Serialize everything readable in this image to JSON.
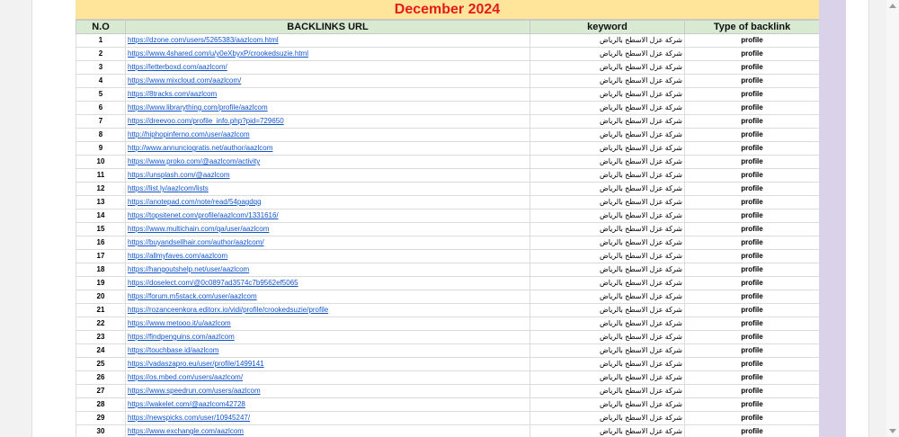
{
  "title": "December 2024",
  "headers": {
    "no": "N.O",
    "url": "BACKLINKS URL",
    "keyword": "keyword",
    "type": "Type of backlink"
  },
  "rows": [
    {
      "no": "1",
      "url": "https://dzone.com/users/5265383/aazlcom.html",
      "keyword": "شركة عزل الاسطح بالرياض",
      "type": "profile"
    },
    {
      "no": "2",
      "url": "https://www.4shared.com/u/y0eXbyxP/crookedsuzie.html",
      "keyword": "شركة عزل الاسطح بالرياض",
      "type": "profile"
    },
    {
      "no": "3",
      "url": "https://letterboxd.com/aazlcom/",
      "keyword": "شركة عزل الاسطح بالرياض",
      "type": "profile"
    },
    {
      "no": "4",
      "url": "https://www.mixcloud.com/aazlcom/",
      "keyword": "شركة عزل الاسطح بالرياض",
      "type": "profile"
    },
    {
      "no": "5",
      "url": "https://8tracks.com/aazlcom",
      "keyword": "شركة عزل الاسطح بالرياض",
      "type": "profile"
    },
    {
      "no": "6",
      "url": "https://www.librarything.com/profile/aazlcom",
      "keyword": "شركة عزل الاسطح بالرياض",
      "type": "profile"
    },
    {
      "no": "7",
      "url": "https://dreevoo.com/profile_info.php?pid=729650",
      "keyword": "شركة عزل الاسطح بالرياض",
      "type": "profile"
    },
    {
      "no": "8",
      "url": "http://hiphopinferno.com/user/aazlcom",
      "keyword": "شركة عزل الاسطح بالرياض",
      "type": "profile"
    },
    {
      "no": "9",
      "url": "http://www.annunciogratis.net/author/aazlcom",
      "keyword": "شركة عزل الاسطح بالرياض",
      "type": "profile"
    },
    {
      "no": "10",
      "url": "https://www.proko.com/@aazlcom/activity",
      "keyword": "شركة عزل الاسطح بالرياض",
      "type": "profile"
    },
    {
      "no": "11",
      "url": "https://unsplash.com/@aazlcom",
      "keyword": "شركة عزل الاسطح بالرياض",
      "type": "profile"
    },
    {
      "no": "12",
      "url": "https://list.ly/aazlcom/lists",
      "keyword": "شركة عزل الاسطح بالرياض",
      "type": "profile"
    },
    {
      "no": "13",
      "url": "https://anotepad.com/note/read/54pagdqq",
      "keyword": "شركة عزل الاسطح بالرياض",
      "type": "profile"
    },
    {
      "no": "14",
      "url": "https://topsitenet.com/profile/aazlcom/1331616/",
      "keyword": "شركة عزل الاسطح بالرياض",
      "type": "profile"
    },
    {
      "no": "15",
      "url": "https://www.multichain.com/qa/user/aazlcom",
      "keyword": "شركة عزل الاسطح بالرياض",
      "type": "profile"
    },
    {
      "no": "16",
      "url": "https://buyandsellhair.com/author/aazlcom/",
      "keyword": "شركة عزل الاسطح بالرياض",
      "type": "profile"
    },
    {
      "no": "17",
      "url": "https://allmyfaves.com/aazlcom",
      "keyword": "شركة عزل الاسطح بالرياض",
      "type": "profile"
    },
    {
      "no": "18",
      "url": "https://hangoutshelp.net/user/aazlcom",
      "keyword": "شركة عزل الاسطح بالرياض",
      "type": "profile"
    },
    {
      "no": "19",
      "url": "https://doselect.com/@0c0897ad3574c7b9562ef5065",
      "keyword": "شركة عزل الاسطح بالرياض",
      "type": "profile"
    },
    {
      "no": "20",
      "url": "https://forum.m5stack.com/user/aazlcom",
      "keyword": "شركة عزل الاسطح بالرياض",
      "type": "profile"
    },
    {
      "no": "21",
      "url": "https://rozanceenkora.editorx.io/vidi/profile/crookedsuzie/profile",
      "keyword": "شركة عزل الاسطح بالرياض",
      "type": "profile"
    },
    {
      "no": "22",
      "url": "https://www.metooo.it/u/aazlcom",
      "keyword": "شركة عزل الاسطح بالرياض",
      "type": "profile"
    },
    {
      "no": "23",
      "url": "https://findpenguins.com/aazlcom",
      "keyword": "شركة عزل الاسطح بالرياض",
      "type": "profile"
    },
    {
      "no": "24",
      "url": "https://touchbase.id/aazlcom",
      "keyword": "شركة عزل الاسطح بالرياض",
      "type": "profile"
    },
    {
      "no": "25",
      "url": "https://vadaszapro.eu/user/profile/1499141",
      "keyword": "شركة عزل الاسطح بالرياض",
      "type": "profile"
    },
    {
      "no": "26",
      "url": "https://os.mbed.com/users/aazlcom/",
      "keyword": "شركة عزل الاسطح بالرياض",
      "type": "profile"
    },
    {
      "no": "27",
      "url": "https://www.speedrun.com/users/aazlcom",
      "keyword": "شركة عزل الاسطح بالرياض",
      "type": "profile"
    },
    {
      "no": "28",
      "url": "https://wakelet.com/@aazlcom42728",
      "keyword": "شركة عزل الاسطح بالرياض",
      "type": "profile"
    },
    {
      "no": "29",
      "url": "https://newspicks.com/user/10945247/",
      "keyword": "شركة عزل الاسطح بالرياض",
      "type": "profile"
    },
    {
      "no": "30",
      "url": "https://www.exchangle.com/aazlcom",
      "keyword": "شركة عزل الاسطح بالرياض",
      "type": "profile"
    }
  ]
}
